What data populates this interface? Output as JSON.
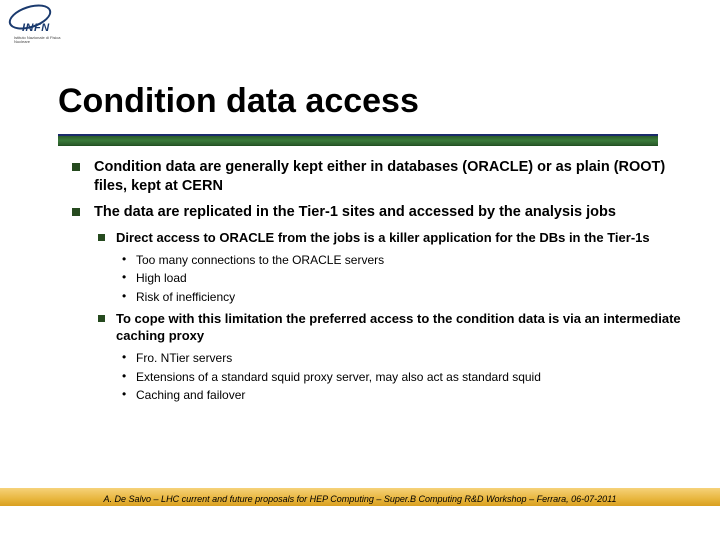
{
  "logo": {
    "abbr": "INFN",
    "sub": "Istituto Nazionale di Fisica Nucleare"
  },
  "title": "Condition data access",
  "bullets": [
    {
      "text": "Condition data are generally kept either in databases (ORACLE) or as plain (ROOT) files, kept at CERN"
    },
    {
      "text": "The data are replicated in the Tier-1 sites and accessed by the analysis jobs",
      "children": [
        {
          "text": "Direct access to ORACLE from the jobs is a killer application for the DBs in the Tier-1s",
          "children": [
            {
              "text": "Too many connections to the ORACLE servers"
            },
            {
              "text": "High load"
            },
            {
              "text": "Risk of inefficiency"
            }
          ]
        },
        {
          "text": "To cope with this limitation the preferred access to the condition data is via an intermediate caching proxy",
          "children": [
            {
              "text": "Fro. NTier servers"
            },
            {
              "text": "Extensions of a standard squid proxy server, may also act as standard squid"
            },
            {
              "text": "Caching and failover"
            }
          ]
        }
      ]
    }
  ],
  "footer": "A. De Salvo – LHC current and future proposals for HEP Computing – Super.B Computing R&D Workshop – Ferrara, 06-07-2011"
}
